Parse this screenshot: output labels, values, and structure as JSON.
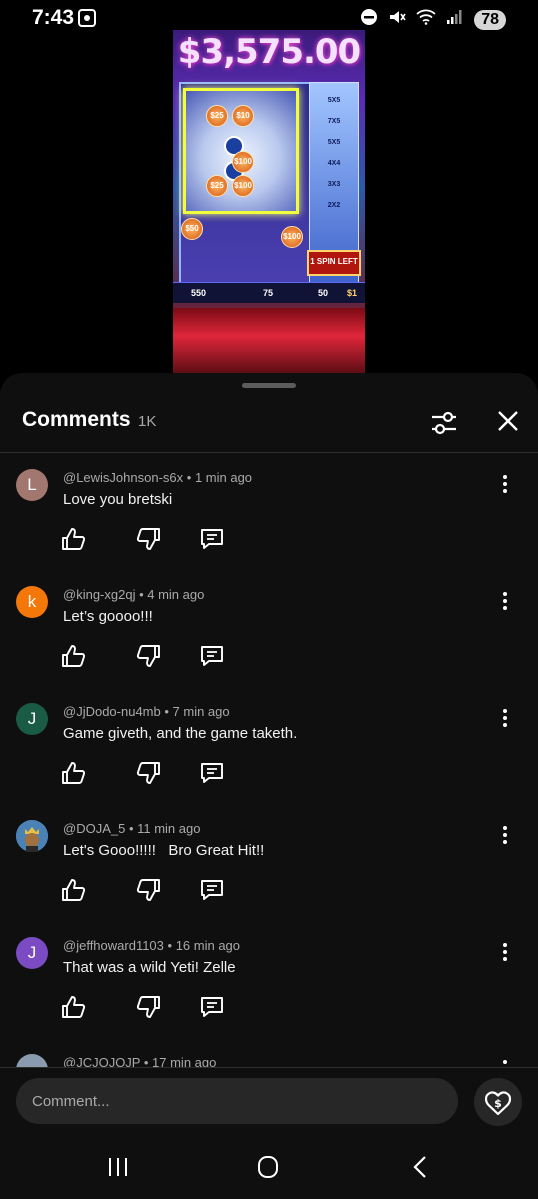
{
  "status_bar": {
    "time": "7:43",
    "battery": "78"
  },
  "video": {
    "jackpot": "$3,575.00",
    "spin_left": "1 SPIN LEFT",
    "credit": "550",
    "bet": "75",
    "win": "50",
    "denom": "$1"
  },
  "comments_panel": {
    "title": "Comments",
    "count": "1K",
    "items": [
      {
        "author": "@LewisJohnson-s6x",
        "time": "1 min ago",
        "text": "Love you bretski",
        "avatar_letter": "L",
        "avatar_color": "#a1776f"
      },
      {
        "author": "@king-xg2qj",
        "time": "4 min ago",
        "text": "Let’s goooo!!!",
        "avatar_letter": "k",
        "avatar_color": "#f4770a"
      },
      {
        "author": "@JjDodo-nu4mb",
        "time": "7 min ago",
        "text": "Game giveth, and the game taketh.",
        "avatar_letter": "J",
        "avatar_color": "#1a5b46"
      },
      {
        "author": "@DOJA_5",
        "time": "11 min ago",
        "text": "Let's Gooo!!!!!   Bro Great Hit!!",
        "avatar_letter": "",
        "avatar_color": "#4a82b5"
      },
      {
        "author": "@jeffhoward1103",
        "time": "16 min ago",
        "text": "That was a wild Yeti! Zelle",
        "avatar_letter": "J",
        "avatar_color": "#7b4bc3"
      },
      {
        "author": "@JCJOJOJP",
        "time": "17 min ago",
        "text": "",
        "avatar_letter": "",
        "avatar_color": "#8a9bb0"
      }
    ]
  },
  "input": {
    "placeholder": "Comment..."
  },
  "colors": {
    "sheet_bg": "#0f0f0f",
    "input_bg": "#272727",
    "meta_text": "#aaaaaa"
  }
}
